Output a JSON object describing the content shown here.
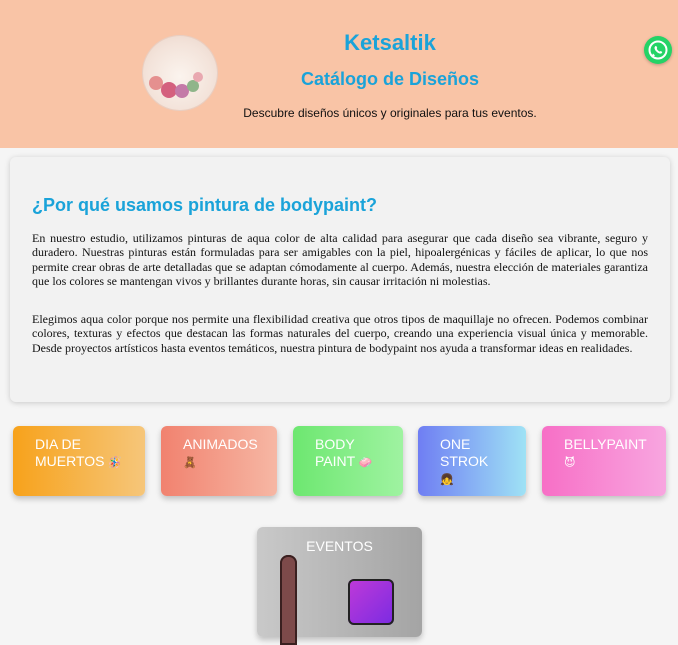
{
  "header": {
    "title": "Ketsaltik",
    "subtitle": "Catálogo de Diseños",
    "tagline": "Descubre diseños únicos y originales para tus eventos.",
    "logo_icon": "ketsaltik-floral-logo",
    "whatsapp_icon": "whatsapp-icon"
  },
  "about": {
    "heading": "¿Por qué usamos pintura de bodypaint?",
    "paragraph1": "En nuestro estudio, utilizamos pinturas de aqua color de alta calidad para asegurar que cada diseño sea vibrante, seguro y duradero. Nuestras pinturas están formuladas para ser amigables con la piel, hipoalergénicas y fáciles de aplicar, lo que nos permite crear obras de arte detalladas que se adaptan cómodamente al cuerpo. Además, nuestra elección de materiales garantiza que los colores se mantengan vivos y brillantes durante horas, sin causar irritación ni molestias.",
    "paragraph2": "Elegimos aqua color porque nos permite una flexibilidad creativa que otros tipos de maquillaje no ofrecen. Podemos combinar colores, texturas y efectos que destacan las formas naturales del cuerpo, creando una experiencia visual única y memorable. Desde proyectos artísticos hasta eventos temáticos, nuestra pintura de bodypaint nos ayuda a transformar ideas en realidades."
  },
  "categories": [
    {
      "line1": "DIA DE",
      "line2": "MUERTOS",
      "emoji": "🪅",
      "icon": "papel-picado-icon"
    },
    {
      "line1": "ANIMADOS",
      "line2": "",
      "emoji": "🧸",
      "icon": "gingerbread-icon"
    },
    {
      "line1": "BODY",
      "line2": "PAINT",
      "emoji": "🧼",
      "icon": "soap-icon"
    },
    {
      "line1": "ONE",
      "line2": "STROK",
      "emoji": "👧",
      "icon": "girl-face-icon"
    },
    {
      "line1": "BELLYPAINT",
      "line2": "",
      "emoji": "😈",
      "icon": "devil-face-icon"
    }
  ],
  "eventos": {
    "label": "EVENTOS",
    "icon": "paintbrush-palette-icon"
  },
  "colors": {
    "header_bg": "#f9c4a6",
    "accent": "#1aa3d9",
    "whatsapp": "#25d366"
  }
}
